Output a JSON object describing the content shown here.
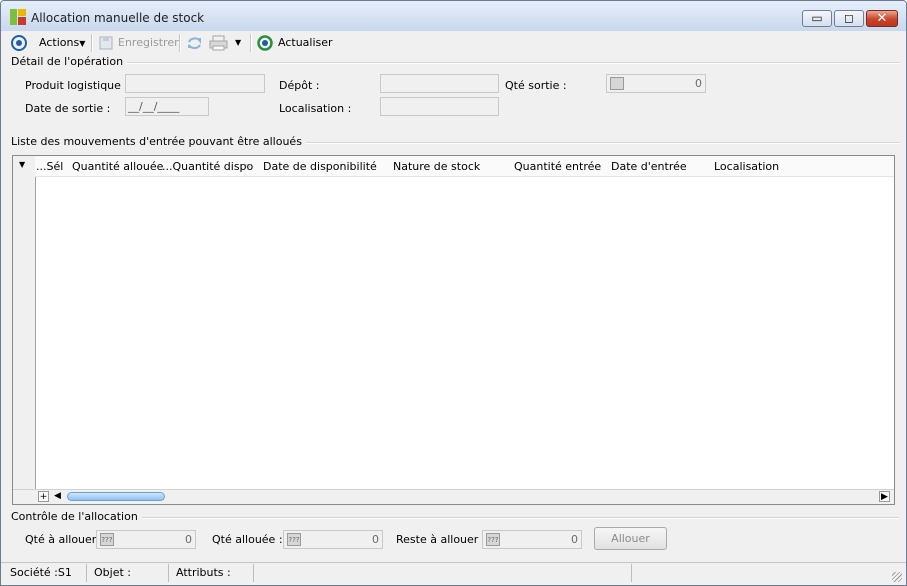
{
  "window": {
    "title": "Allocation manuelle de stock",
    "controls": {
      "minimize": "▭",
      "maximize": "◻",
      "close": "✕"
    }
  },
  "toolbar": {
    "actions_label": "Actions",
    "save_label": "Enregistrer",
    "refresh_label": "Actualiser"
  },
  "detail": {
    "section_title": "Détail de l'opération",
    "produit_label": "Produit logistique :",
    "produit_value": "",
    "date_label": "Date de sortie :",
    "date_value": "__/__/____",
    "depot_label": "Dépôt :",
    "depot_value": "",
    "localisation_label": "Localisation :",
    "localisation_value": "",
    "qte_sortie_label": "Qté sortie :",
    "qte_sortie_value": "0"
  },
  "list": {
    "section_title": "Liste des mouvements d'entrée pouvant être alloués",
    "columns": [
      "...Sél",
      "Quantité allouée",
      "...Quantité dispo",
      "Date de disponibilité",
      "Nature de stock",
      "Quantité entrée",
      "Date d'entrée",
      "Localisation"
    ],
    "rows": []
  },
  "control": {
    "section_title": "Contrôle de l'allocation",
    "qte_a_allouer_label": "Qté à allouer :",
    "qte_a_allouer_value": "0",
    "qte_allouee_label": "Qté allouée :",
    "qte_allouee_value": "0",
    "reste_label": "Reste à allouer :",
    "reste_value": "0",
    "allouer_label": "Allouer",
    "unknown_glyph": "???"
  },
  "status": {
    "societe": "Société :S1",
    "objet": "Objet :",
    "attributs": "Attributs :"
  },
  "colors": {
    "accent": "#1f5fa8",
    "close": "#c8442a"
  }
}
